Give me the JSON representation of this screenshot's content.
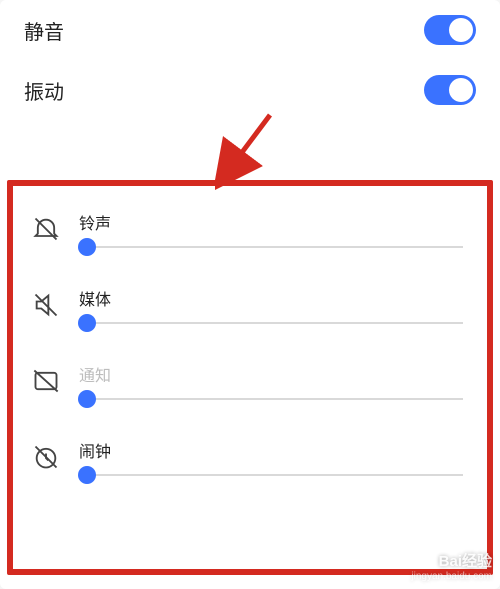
{
  "toggles": {
    "mute": {
      "label": "静音",
      "on": true
    },
    "vibrate": {
      "label": "振动",
      "on": true
    }
  },
  "sliders": {
    "ringtone": {
      "label": "铃声",
      "value": 2,
      "muted": false
    },
    "media": {
      "label": "媒体",
      "value": 2,
      "muted": false
    },
    "notify": {
      "label": "通知",
      "value": 2,
      "muted": true
    },
    "alarm": {
      "label": "闹钟",
      "value": 2,
      "muted": false
    }
  },
  "watermark": {
    "main": "Bai经验",
    "sub": "jingyan.baidu.com"
  },
  "colors": {
    "accent": "#3a72ff",
    "highlight": "#d42a20"
  }
}
